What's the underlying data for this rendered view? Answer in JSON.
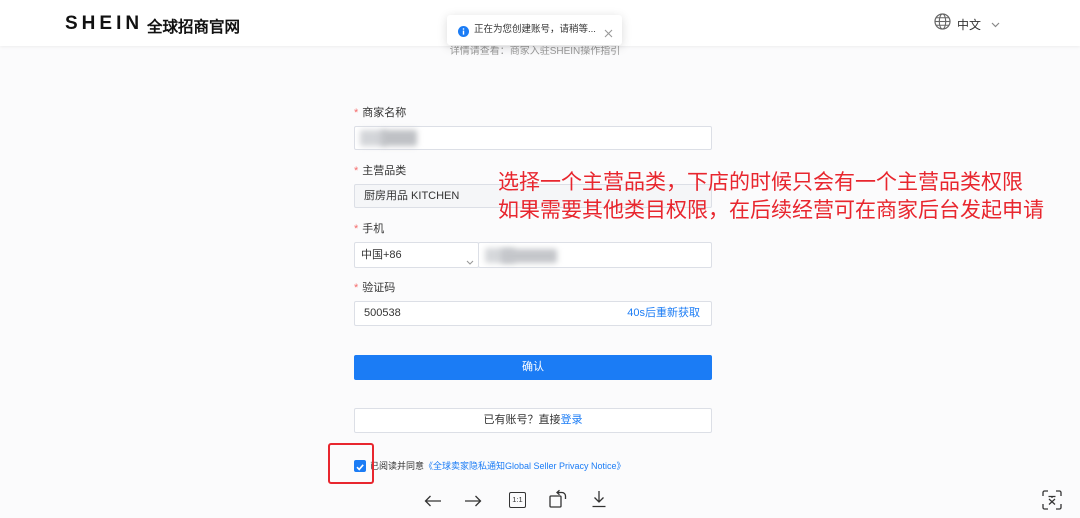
{
  "header": {
    "logo": "SHEIN",
    "site_name": "全球招商官网",
    "language": "中文"
  },
  "toast": {
    "message": "正在为您创建账号，请稍等...",
    "icon": "info-icon"
  },
  "guide_text": "详情请查看：商家入驻SHEIN操作指引",
  "form": {
    "required_mark": "*",
    "merchant_name": {
      "label": "商家名称"
    },
    "main_category": {
      "label": "主营品类",
      "value": "厨房用品 KITCHEN"
    },
    "phone": {
      "label": "手机",
      "country_code": "中国+86"
    },
    "verification_code": {
      "label": "验证码",
      "value": "500538",
      "resend_label": "40s后重新获取"
    },
    "confirm_label": "确认",
    "login_prompt": "已有账号？直接",
    "login_link": "登录",
    "agreement": {
      "checked": true,
      "prefix": "已阅读并同意",
      "link": "《全球卖家隐私通知Global Seller Privacy Notice》"
    }
  },
  "annotation": {
    "lines": [
      "选择一个主营品类，下店的时候只会有一个主营品类权限",
      "如果需要其他类目权限，在后续经营可在商家后台发起申请"
    ]
  },
  "viewer_toolbar": {
    "zoom_label": "1:1",
    "icons": [
      "arrow-left-icon",
      "arrow-right-icon",
      "actual-size-icon",
      "rotate-icon",
      "download-icon",
      "extract-text-icon"
    ]
  },
  "colors": {
    "primary": "#1b7cf5",
    "required": "#f56c6c",
    "annotation": "#e8262e",
    "page_background": "#fbfbfc"
  }
}
